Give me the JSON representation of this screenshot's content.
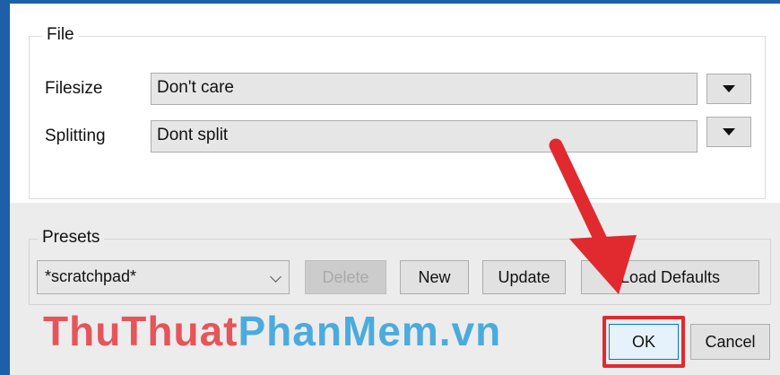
{
  "file_group": {
    "title": "File",
    "rows": [
      {
        "label": "Filesize",
        "value": "Don't care"
      },
      {
        "label": "Splitting",
        "value": "Dont split"
      }
    ]
  },
  "presets_group": {
    "title": "Presets",
    "selected": "*scratchpad*",
    "buttons": {
      "delete": "Delete",
      "new": "New",
      "update": "Update",
      "load_defaults": "Load Defaults"
    }
  },
  "dialog_buttons": {
    "ok": "OK",
    "cancel": "Cancel"
  },
  "watermark": {
    "part1": "ThuThuat",
    "part2": "PhanMem",
    "part3": ".vn"
  },
  "colors": {
    "annotation": "#e02a2f",
    "watermark_red": "#e54a4f",
    "watermark_blue": "#3fa7dc",
    "window_border": "#1d5fa8"
  }
}
